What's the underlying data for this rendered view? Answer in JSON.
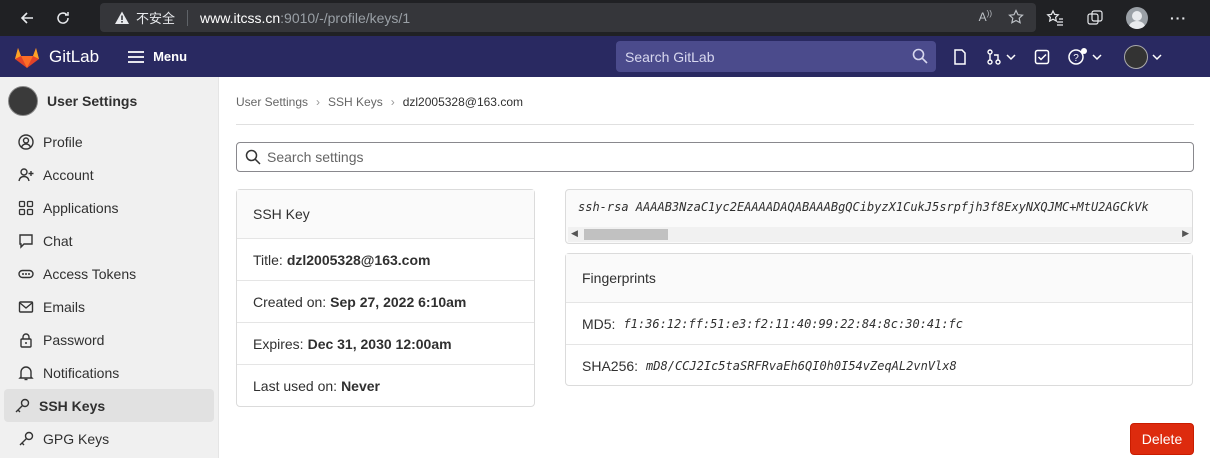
{
  "browser": {
    "security_label": "不安全",
    "url_host": "www.itcss.cn",
    "url_path": ":9010/-/profile/keys/1"
  },
  "header": {
    "brand": "GitLab",
    "menu_label": "Menu",
    "search_placeholder": "Search GitLab"
  },
  "sidebar": {
    "title": "User Settings",
    "items": [
      {
        "label": "Profile",
        "icon": "profile-icon"
      },
      {
        "label": "Account",
        "icon": "account-icon"
      },
      {
        "label": "Applications",
        "icon": "applications-icon"
      },
      {
        "label": "Chat",
        "icon": "chat-icon"
      },
      {
        "label": "Access Tokens",
        "icon": "token-icon"
      },
      {
        "label": "Emails",
        "icon": "mail-icon"
      },
      {
        "label": "Password",
        "icon": "lock-icon"
      },
      {
        "label": "Notifications",
        "icon": "bell-icon"
      },
      {
        "label": "SSH Keys",
        "icon": "key-icon",
        "active": true
      },
      {
        "label": "GPG Keys",
        "icon": "key-icon"
      }
    ]
  },
  "breadcrumb": {
    "items": [
      "User Settings",
      "SSH Keys",
      "dzl2005328@163.com"
    ]
  },
  "search_settings": {
    "placeholder": "Search settings"
  },
  "ssh_key": {
    "heading": "SSH Key",
    "title_label": "Title:",
    "title_value": "dzl2005328@163.com",
    "created_label": "Created on:",
    "created_value": "Sep 27, 2022 6:10am",
    "expires_label": "Expires:",
    "expires_value": "Dec 31, 2030 12:00am",
    "last_used_label": "Last used on:",
    "last_used_value": "Never",
    "key_text": "ssh-rsa AAAAB3NzaC1yc2EAAAADAQABAAABgQCibyzX1CukJ5srpfjh3f8ExyNXQJMC+MtU2AGCkVk"
  },
  "fingerprints": {
    "heading": "Fingerprints",
    "md5_label": "MD5:",
    "md5_value": "f1:36:12:ff:51:e3:f2:11:40:99:22:84:8c:30:41:fc",
    "sha256_label": "SHA256:",
    "sha256_value": "mD8/CCJ2Ic5taSRFRvaEh6QI0h0I54vZeqAL2vnVlx8"
  },
  "actions": {
    "delete_label": "Delete"
  },
  "colors": {
    "header_bg": "#292961",
    "danger": "#dd2b0e",
    "browser_bg": "#202124"
  }
}
